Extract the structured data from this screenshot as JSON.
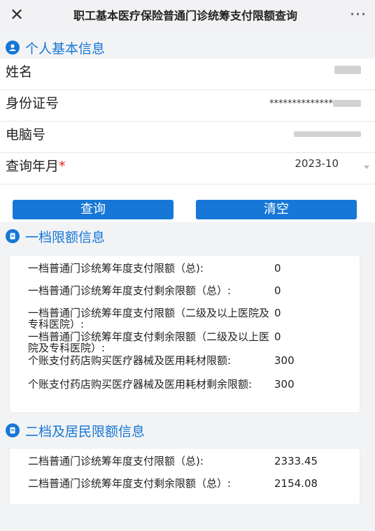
{
  "header": {
    "close_icon": "close-icon",
    "title": "职工基本医疗保险普通门诊统筹支付限额查询",
    "more_label": "···"
  },
  "personal": {
    "section_title": "个人基本信息",
    "icon": "user-circle-icon",
    "name_label": "姓名",
    "id_label": "身份证号",
    "id_value": "**************",
    "computer_label": "电脑号",
    "query_label": "查询年月",
    "required_mark": "*",
    "query_value": "2023-10"
  },
  "buttons": {
    "query": "查询",
    "clear": "清空"
  },
  "tier1": {
    "section_title": "一档限额信息",
    "icon": "document-icon",
    "items": [
      {
        "label": "一档普通门诊统筹年度支付限额（总):",
        "value": "0"
      },
      {
        "label": "一档普通门诊统筹年度支付剩余限额（总）:",
        "value": "0"
      },
      {
        "label": "一档普通门诊统筹年度支付限额（二级及以上医院及专科医院）:",
        "value": "0"
      },
      {
        "label": "一档普通门诊统筹年度支付剩余限额（二级及以上医院及专科医院）:",
        "value": "0"
      },
      {
        "label": "个账支付药店购买医疗器械及医用耗材限额:",
        "value": "300"
      },
      {
        "label": "个账支付药店购买医疗器械及医用耗材剩余限额:",
        "value": "300"
      }
    ]
  },
  "tier2": {
    "section_title": "二档及居民限额信息",
    "icon": "document-icon",
    "items": [
      {
        "label": "二档普通门诊统筹年度支付限额（总):",
        "value": "2333.45"
      },
      {
        "label": "二档普通门诊统筹年度支付剩余限额（总）:",
        "value": "2154.08"
      }
    ]
  }
}
